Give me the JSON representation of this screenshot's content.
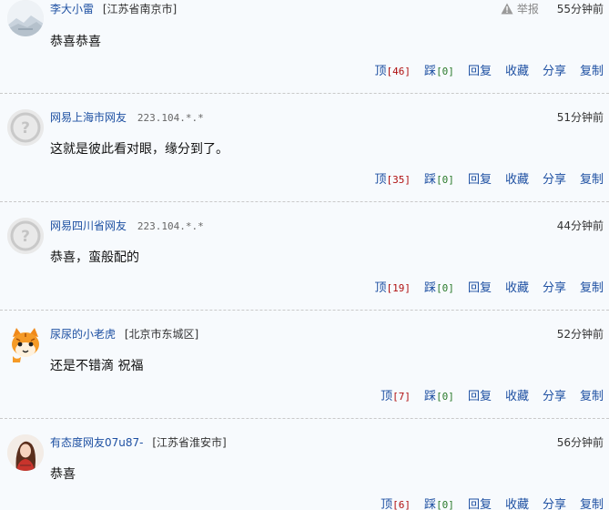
{
  "comments": [
    {
      "username": "李大小雷",
      "location": "[江苏省南京市]",
      "ip": "",
      "report_label": "举报",
      "time": "55分钟前",
      "content": "恭喜恭喜",
      "up_label": "顶",
      "up_count": "[46]",
      "down_label": "踩",
      "down_count": "[0]",
      "reply_label": "回复",
      "fav_label": "收藏",
      "share_label": "分享",
      "copy_label": "复制",
      "avatar": "landscape-avatar"
    },
    {
      "username": "网易上海市网友",
      "location": "",
      "ip": "223.104.*.*",
      "report_label": "",
      "time": "51分钟前",
      "content": "这就是彼此看对眼，缘分到了。",
      "up_label": "顶",
      "up_count": "[35]",
      "down_label": "踩",
      "down_count": "[0]",
      "reply_label": "回复",
      "fav_label": "收藏",
      "share_label": "分享",
      "copy_label": "复制",
      "avatar": "default-avatar"
    },
    {
      "username": "网易四川省网友",
      "location": "",
      "ip": "223.104.*.*",
      "report_label": "",
      "time": "44分钟前",
      "content": "恭喜，蛮般配的",
      "up_label": "顶",
      "up_count": "[19]",
      "down_label": "踩",
      "down_count": "[0]",
      "reply_label": "回复",
      "fav_label": "收藏",
      "share_label": "分享",
      "copy_label": "复制",
      "avatar": "default-avatar"
    },
    {
      "username": "尿尿的小老虎",
      "location": "[北京市东城区]",
      "ip": "",
      "report_label": "",
      "time": "52分钟前",
      "content": "还是不错滴 祝福",
      "up_label": "顶",
      "up_count": "[7]",
      "down_label": "踩",
      "down_count": "[0]",
      "reply_label": "回复",
      "fav_label": "收藏",
      "share_label": "分享",
      "copy_label": "复制",
      "avatar": "cartoon-cat-avatar"
    },
    {
      "username": "有态度网友07u87-",
      "location": "[江苏省淮安市]",
      "ip": "",
      "report_label": "",
      "time": "56分钟前",
      "content": "恭喜",
      "up_label": "顶",
      "up_count": "[6]",
      "down_label": "踩",
      "down_count": "[0]",
      "reply_label": "回复",
      "fav_label": "收藏",
      "share_label": "分享",
      "copy_label": "复制",
      "avatar": "woman-photo-avatar"
    }
  ],
  "colors": {
    "link": "#1e50a2",
    "up_count": "#b01010",
    "down_count": "#2a7a2a",
    "background": "#f7fafd"
  }
}
